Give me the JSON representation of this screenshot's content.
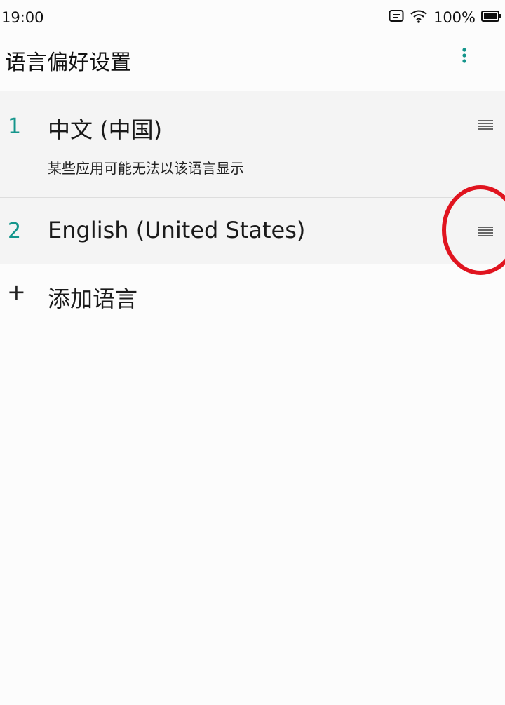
{
  "status_bar": {
    "time": "19:00",
    "battery": "100%",
    "icons": [
      "message-icon",
      "wifi-icon",
      "battery-icon"
    ]
  },
  "app_bar": {
    "title": "语言偏好设置",
    "menu_icon": "more-vert-icon",
    "accent_color": "#14958b"
  },
  "languages": [
    {
      "index": "1",
      "name": "中文 (中国)",
      "note": "某些应用可能无法以该语言显示",
      "handle_icon": "drag-handle-icon"
    },
    {
      "index": "2",
      "name": "English (United States)",
      "handle_icon": "drag-handle-icon"
    }
  ],
  "add_language": {
    "icon": "+",
    "label": "添加语言"
  },
  "annotation": {
    "color": "#e0141f"
  }
}
